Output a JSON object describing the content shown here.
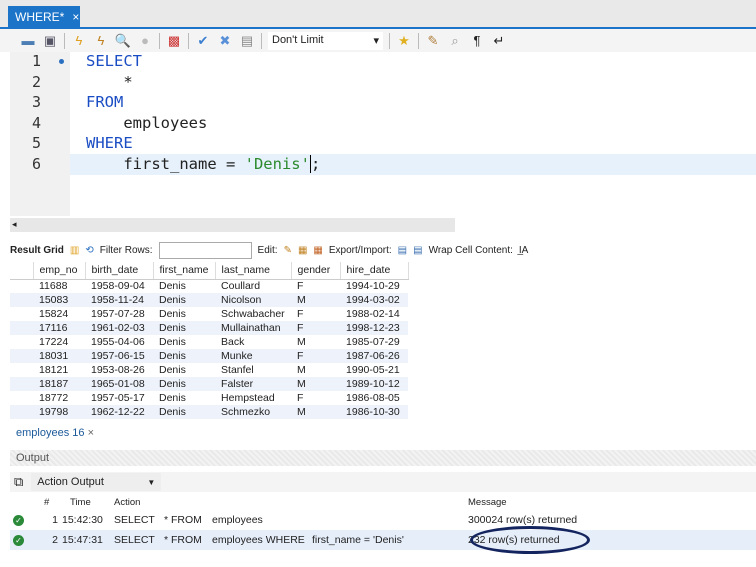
{
  "tab": {
    "title": "WHERE*",
    "close": "×"
  },
  "toolbar": {
    "limit": "Don't Limit",
    "icons": [
      "open-folder-icon",
      "save-icon",
      "execute-icon",
      "execute-current-icon",
      "explain-icon",
      "stop-icon",
      "toggle-icon",
      "commit-icon",
      "rollback-icon",
      "autocommit-icon",
      "favorite-icon",
      "beautify-icon",
      "find-icon",
      "invisible-chars-icon",
      "wrap-icon"
    ]
  },
  "editor": {
    "lines": [
      {
        "n": "1",
        "text": "SELECT",
        "type": "kw"
      },
      {
        "n": "2",
        "text": "    *",
        "type": "plain"
      },
      {
        "n": "3",
        "text": "FROM",
        "type": "kw"
      },
      {
        "n": "4",
        "text": "    employees",
        "type": "plain"
      },
      {
        "n": "5",
        "text": "WHERE",
        "type": "kw"
      },
      {
        "n": "6",
        "pre": "    first_name = ",
        "str": "'Denis'",
        "post": ";"
      }
    ]
  },
  "result_toolbar": {
    "result_grid": "Result Grid",
    "filter_rows": "Filter Rows:",
    "edit": "Edit:",
    "export_import": "Export/Import:",
    "wrap_cell": "Wrap Cell Content:"
  },
  "grid": {
    "columns": [
      "emp_no",
      "birth_date",
      "first_name",
      "last_name",
      "gender",
      "hire_date"
    ],
    "rows": [
      [
        "11688",
        "1958-09-04",
        "Denis",
        "Coullard",
        "F",
        "1994-10-29"
      ],
      [
        "15083",
        "1958-11-24",
        "Denis",
        "Nicolson",
        "M",
        "1994-03-02"
      ],
      [
        "15824",
        "1957-07-28",
        "Denis",
        "Schwabacher",
        "F",
        "1988-02-14"
      ],
      [
        "17116",
        "1961-02-03",
        "Denis",
        "Mullainathan",
        "F",
        "1998-12-23"
      ],
      [
        "17224",
        "1955-04-06",
        "Denis",
        "Back",
        "M",
        "1985-07-29"
      ],
      [
        "18031",
        "1957-06-15",
        "Denis",
        "Munke",
        "F",
        "1987-06-26"
      ],
      [
        "18121",
        "1953-08-26",
        "Denis",
        "Stanfel",
        "M",
        "1990-05-21"
      ],
      [
        "18187",
        "1965-01-08",
        "Denis",
        "Falster",
        "M",
        "1989-10-12"
      ],
      [
        "18772",
        "1957-05-17",
        "Denis",
        "Hempstead",
        "F",
        "1986-08-05"
      ],
      [
        "19798",
        "1962-12-22",
        "Denis",
        "Schmezko",
        "M",
        "1986-10-30"
      ]
    ]
  },
  "result_tab": {
    "label": "employees 16",
    "close": "×"
  },
  "output": {
    "title": "Output",
    "selector": "Action Output",
    "columns": [
      "#",
      "Time",
      "Action",
      "Message"
    ],
    "rows": [
      {
        "n": "1",
        "time": "15:42:30",
        "a1": "SELECT",
        "a2": "* FROM",
        "a3": "employees",
        "a4": "",
        "msg": "300024 row(s) returned"
      },
      {
        "n": "2",
        "time": "15:47:31",
        "a1": "SELECT",
        "a2": "* FROM",
        "a3": "employees WHERE",
        "a4": "first_name = 'Denis'",
        "msg": "232 row(s) returned"
      }
    ]
  },
  "colors": {
    "accent": "#1c74c8",
    "annotation": "#13245e",
    "success": "#2a8a3a"
  }
}
